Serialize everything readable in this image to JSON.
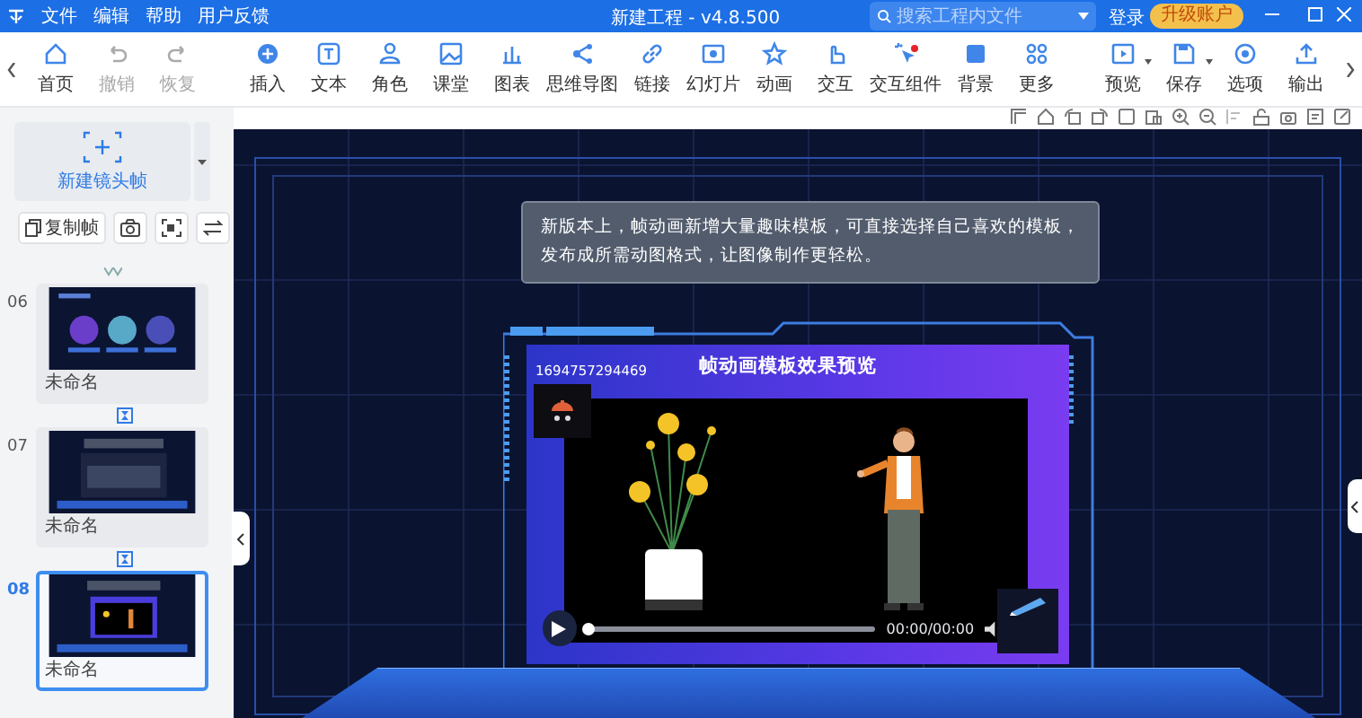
{
  "title_bar": {
    "menu": [
      "文件",
      "编辑",
      "帮助",
      "用户反馈"
    ],
    "title": "新建工程 - v4.8.500",
    "search": {
      "placeholder": "搜索工程内文件"
    },
    "login": "登录",
    "upgrade": "升级账户"
  },
  "toolbar": {
    "groups": [
      {
        "tools": [
          {
            "label": "首页",
            "disabled": false,
            "dropdown": false,
            "badge": false
          },
          {
            "label": "撤销",
            "disabled": true,
            "dropdown": false,
            "badge": false
          },
          {
            "label": "恢复",
            "disabled": true,
            "dropdown": false,
            "badge": false
          }
        ]
      },
      {
        "tools": [
          {
            "label": "插入",
            "disabled": false,
            "dropdown": false,
            "badge": false
          },
          {
            "label": "文本",
            "disabled": false,
            "dropdown": false,
            "badge": false
          },
          {
            "label": "角色",
            "disabled": false,
            "dropdown": false,
            "badge": false
          },
          {
            "label": "课堂",
            "disabled": false,
            "dropdown": false,
            "badge": false
          },
          {
            "label": "图表",
            "disabled": false,
            "dropdown": false,
            "badge": false
          },
          {
            "label": "思维导图",
            "disabled": false,
            "dropdown": false,
            "badge": false
          },
          {
            "label": "链接",
            "disabled": false,
            "dropdown": false,
            "badge": false
          },
          {
            "label": "幻灯片",
            "disabled": false,
            "dropdown": false,
            "badge": false
          },
          {
            "label": "动画",
            "disabled": false,
            "dropdown": false,
            "badge": false
          },
          {
            "label": "交互",
            "disabled": false,
            "dropdown": false,
            "badge": false
          },
          {
            "label": "交互组件",
            "disabled": false,
            "dropdown": false,
            "badge": true
          },
          {
            "label": "背景",
            "disabled": false,
            "dropdown": false,
            "badge": false
          },
          {
            "label": "更多",
            "disabled": false,
            "dropdown": false,
            "badge": false
          }
        ]
      },
      {
        "tools": [
          {
            "label": "预览",
            "disabled": false,
            "dropdown": true,
            "badge": false
          },
          {
            "label": "保存",
            "disabled": false,
            "dropdown": true,
            "badge": false
          },
          {
            "label": "选项",
            "disabled": false,
            "dropdown": false,
            "badge": false
          },
          {
            "label": "输出",
            "disabled": false,
            "dropdown": false,
            "badge": false
          }
        ]
      }
    ]
  },
  "frames_panel": {
    "new_frame": "新建镜头帧",
    "copy_frame": "复制帧",
    "slides": [
      {
        "number": "06",
        "name": "未命名",
        "selected": false
      },
      {
        "number": "07",
        "name": "未命名",
        "selected": false
      },
      {
        "number": "08",
        "name": "未命名",
        "selected": true
      }
    ]
  },
  "canvas": {
    "note_lines": [
      "新版本上，帧动画新增大量趣味模板，可直接选择自己喜欢的模板，",
      "发布成所需动图格式，让图像制作更轻松。"
    ],
    "preview": {
      "id": "1694757294469",
      "title": "帧动画模板效果预览",
      "time": "00:00/00:00",
      "progress": {
        "level": 0
      }
    }
  }
}
